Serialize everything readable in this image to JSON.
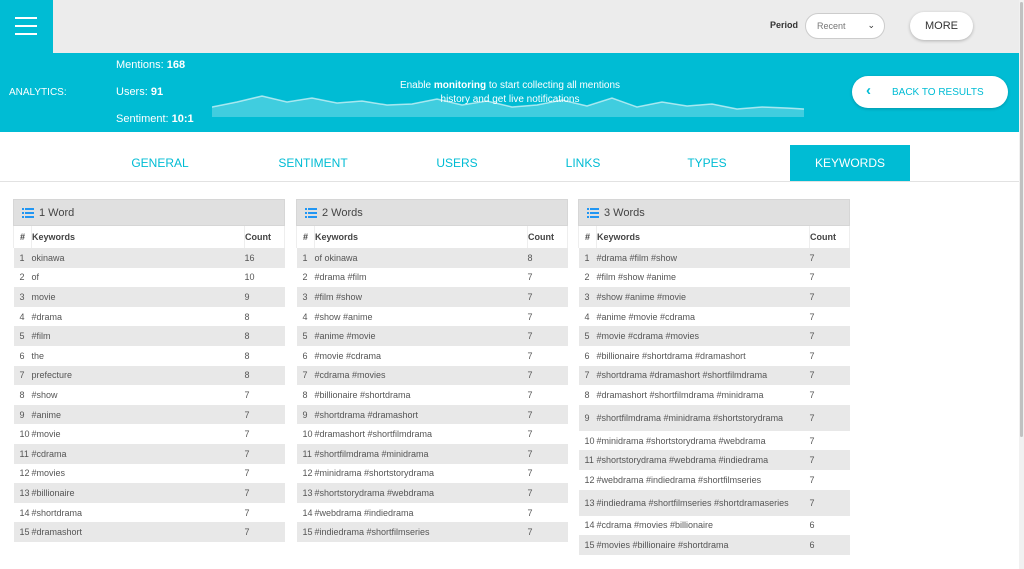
{
  "header": {
    "period_label": "Period",
    "period_value": "Recent",
    "more_label": "MORE"
  },
  "analytics": {
    "label": "ANALYTICS:",
    "mentions_label": "Mentions:",
    "mentions_value": "168",
    "users_label": "Users:",
    "users_value": "91",
    "sentiment_label": "Sentiment:",
    "sentiment_value": "10:1",
    "note_prefix": "Enable",
    "note_bold": "monitoring",
    "note_suffix": "to start collecting all mentions history and get live notifications",
    "back_label": "BACK TO RESULTS"
  },
  "tabs": [
    {
      "label": "GENERAL"
    },
    {
      "label": "SENTIMENT"
    },
    {
      "label": "USERS"
    },
    {
      "label": "LINKS"
    },
    {
      "label": "TYPES"
    },
    {
      "label": "KEYWORDS",
      "active": true
    }
  ],
  "panels": [
    {
      "title": "1 Word",
      "headers": [
        "#",
        "Keywords",
        "Count"
      ],
      "rows": [
        [
          "1",
          "okinawa",
          "16"
        ],
        [
          "2",
          "of",
          "10"
        ],
        [
          "3",
          "movie",
          "9"
        ],
        [
          "4",
          "#drama",
          "8"
        ],
        [
          "5",
          "#film",
          "8"
        ],
        [
          "6",
          "the",
          "8"
        ],
        [
          "7",
          "prefecture",
          "8"
        ],
        [
          "8",
          "#show",
          "7"
        ],
        [
          "9",
          "#anime",
          "7"
        ],
        [
          "10",
          "#movie",
          "7"
        ],
        [
          "11",
          "#cdrama",
          "7"
        ],
        [
          "12",
          "#movies",
          "7"
        ],
        [
          "13",
          "#billionaire",
          "7"
        ],
        [
          "14",
          "#shortdrama",
          "7"
        ],
        [
          "15",
          "#dramashort",
          "7"
        ]
      ]
    },
    {
      "title": "2 Words",
      "headers": [
        "#",
        "Keywords",
        "Count"
      ],
      "rows": [
        [
          "1",
          "of okinawa",
          "8"
        ],
        [
          "2",
          "#drama #film",
          "7"
        ],
        [
          "3",
          "#film #show",
          "7"
        ],
        [
          "4",
          "#show #anime",
          "7"
        ],
        [
          "5",
          "#anime #movie",
          "7"
        ],
        [
          "6",
          "#movie #cdrama",
          "7"
        ],
        [
          "7",
          "#cdrama #movies",
          "7"
        ],
        [
          "8",
          "#billionaire #shortdrama",
          "7"
        ],
        [
          "9",
          "#shortdrama #dramashort",
          "7"
        ],
        [
          "10",
          "#dramashort #shortfilmdrama",
          "7"
        ],
        [
          "11",
          "#shortfilmdrama #minidrama",
          "7"
        ],
        [
          "12",
          "#minidrama #shortstorydrama",
          "7"
        ],
        [
          "13",
          "#shortstorydrama #webdrama",
          "7"
        ],
        [
          "14",
          "#webdrama #indiedrama",
          "7"
        ],
        [
          "15",
          "#indiedrama #shortfilmseries",
          "7"
        ]
      ]
    },
    {
      "title": "3 Words",
      "headers": [
        "#",
        "Keywords",
        "Count"
      ],
      "rows": [
        [
          "1",
          "#drama #film #show",
          "7"
        ],
        [
          "2",
          "#film #show #anime",
          "7"
        ],
        [
          "3",
          "#show #anime #movie",
          "7"
        ],
        [
          "4",
          "#anime #movie #cdrama",
          "7"
        ],
        [
          "5",
          "#movie #cdrama #movies",
          "7"
        ],
        [
          "6",
          "#billionaire #shortdrama #dramashort",
          "7"
        ],
        [
          "7",
          "#shortdrama #dramashort #shortfilmdrama",
          "7"
        ],
        [
          "8",
          "#dramashort #shortfilmdrama #minidrama",
          "7"
        ],
        [
          "9",
          "#shortfilmdrama #minidrama #shortstorydrama",
          "7"
        ],
        [
          "10",
          "#minidrama #shortstorydrama #webdrama",
          "7"
        ],
        [
          "11",
          "#shortstorydrama #webdrama #indiedrama",
          "7"
        ],
        [
          "12",
          "#webdrama #indiedrama #shortfilmseries",
          "7"
        ],
        [
          "13",
          "#indiedrama #shortfilmseries #shortdramaseries",
          "7"
        ],
        [
          "14",
          "#cdrama #movies #billionaire",
          "6"
        ],
        [
          "15",
          "#movies #billionaire #shortdrama",
          "6"
        ]
      ]
    }
  ],
  "colors": {
    "accent": "#00bcd4",
    "row_alt": "#e8e8e8",
    "header_gray": "#e0e0e0"
  }
}
